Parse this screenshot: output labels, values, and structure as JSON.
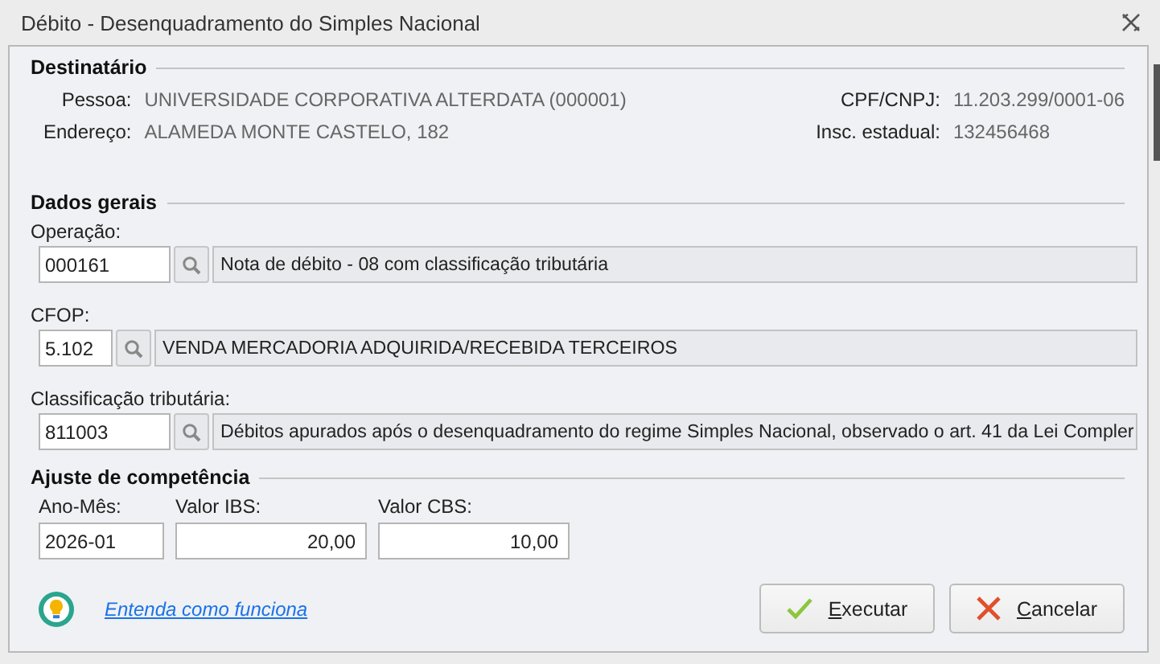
{
  "window": {
    "title": "Débito - Desenquadramento do Simples Nacional"
  },
  "destinatario": {
    "title": "Destinatário",
    "left": [
      {
        "label": "Pessoa:",
        "value": "UNIVERSIDADE CORPORATIVA ALTERDATA (000001)"
      },
      {
        "label": "Endereço:",
        "value": "ALAMEDA MONTE CASTELO, 182"
      }
    ],
    "right": [
      {
        "label": "CPF/CNPJ:",
        "value": "11.203.299/0001-06"
      },
      {
        "label": "Insc. estadual:",
        "value": "132456468"
      }
    ]
  },
  "dados_gerais": {
    "title": "Dados gerais",
    "lookups": [
      {
        "label": "Operação:",
        "code": "000161",
        "description": "Nota de débito - 08 com classificação tributária"
      },
      {
        "label": "CFOP:",
        "code": "5.102",
        "description": "VENDA MERCADORIA ADQUIRIDA/RECEBIDA TERCEIROS"
      },
      {
        "label": "Classificação tributária:",
        "code": "811003",
        "description": "Débitos apurados após o desenquadramento do regime Simples Nacional, observado o art. 41 da Lei Compler"
      }
    ]
  },
  "ajuste": {
    "title": "Ajuste de competência",
    "fields": [
      {
        "label": "Ano-Mês:",
        "value": "2026-01",
        "kind": "text"
      },
      {
        "label": "Valor IBS:",
        "value": "20,00",
        "kind": "number"
      },
      {
        "label": "Valor CBS:",
        "value": "10,00",
        "kind": "number"
      }
    ]
  },
  "footer": {
    "help_link": "Entenda como funciona",
    "buttons": [
      {
        "label": "Executar",
        "kind": "confirm"
      },
      {
        "label": "Cancelar",
        "kind": "cancel"
      }
    ]
  }
}
